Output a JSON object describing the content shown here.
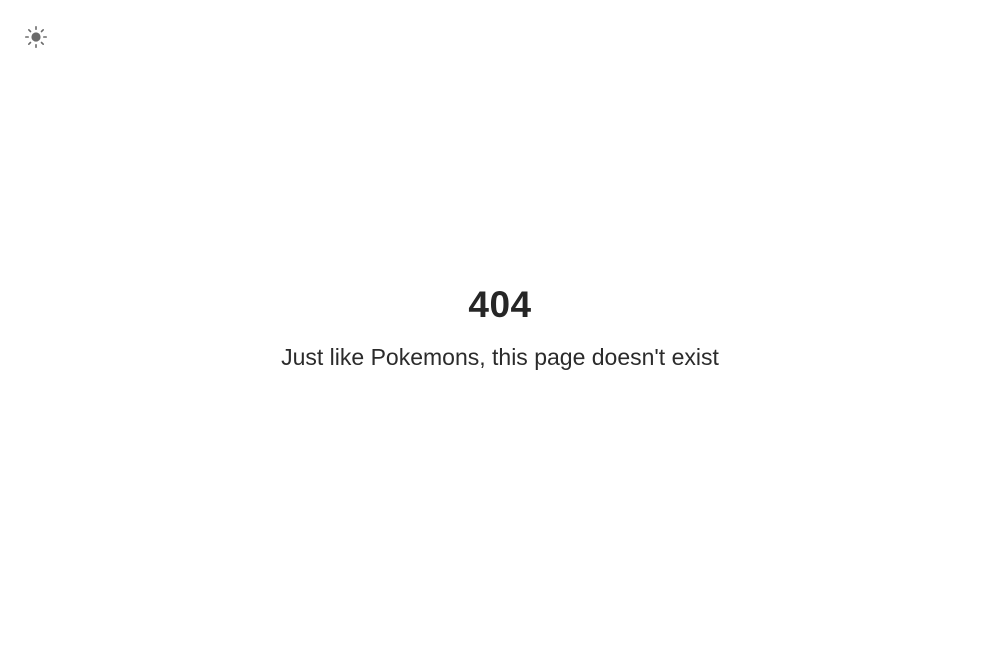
{
  "theme_toggle": {
    "icon": "sun-icon",
    "icon_color": "#6b6b6b"
  },
  "error": {
    "code": "404",
    "message": "Just like Pokemons, this page doesn't exist"
  },
  "colors": {
    "background": "#ffffff",
    "text": "#262626"
  }
}
